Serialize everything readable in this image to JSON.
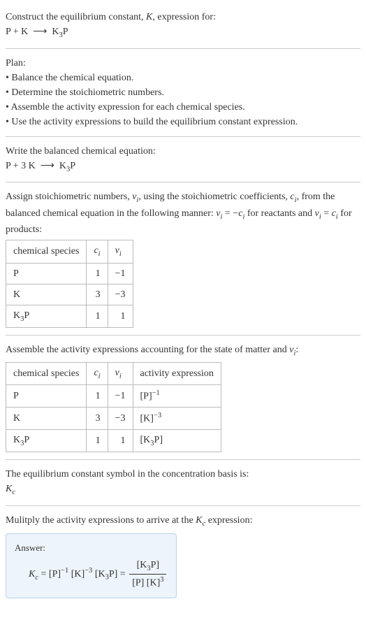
{
  "title": {
    "line1": "Construct the equilibrium constant, K, expression for:",
    "equation": "P + K ⟶ K₃P"
  },
  "plan": {
    "heading": "Plan:",
    "items": [
      "• Balance the chemical equation.",
      "• Determine the stoichiometric numbers.",
      "• Assemble the activity expression for each chemical species.",
      "• Use the activity expressions to build the equilibrium constant expression."
    ]
  },
  "balanced": {
    "heading": "Write the balanced chemical equation:",
    "equation": "P + 3 K ⟶ K₃P"
  },
  "stoich": {
    "text_before": "Assign stoichiometric numbers, νᵢ, using the stoichiometric coefficients, cᵢ, from the balanced chemical equation in the following manner: νᵢ = −cᵢ for reactants and νᵢ = cᵢ for products:",
    "headers": [
      "chemical species",
      "cᵢ",
      "νᵢ"
    ],
    "rows": [
      [
        "P",
        "1",
        "−1"
      ],
      [
        "K",
        "3",
        "−3"
      ],
      [
        "K₃P",
        "1",
        "1"
      ]
    ]
  },
  "activity": {
    "heading": "Assemble the activity expressions accounting for the state of matter and νᵢ:",
    "headers": [
      "chemical species",
      "cᵢ",
      "νᵢ",
      "activity expression"
    ],
    "rows": [
      [
        "P",
        "1",
        "−1",
        "[P]⁻¹"
      ],
      [
        "K",
        "3",
        "−3",
        "[K]⁻³"
      ],
      [
        "K₃P",
        "1",
        "1",
        "[K₃P]"
      ]
    ]
  },
  "symbol": {
    "heading": "The equilibrium constant symbol in the concentration basis is:",
    "value": "K꜀"
  },
  "multiply": {
    "heading": "Mulitply the activity expressions to arrive at the K_c expression:"
  },
  "answer": {
    "label": "Answer:",
    "lhs": "K꜀ = [P]⁻¹ [K]⁻³ [K₃P] = ",
    "frac_num": "[K₃P]",
    "frac_den": "[P] [K]³"
  }
}
